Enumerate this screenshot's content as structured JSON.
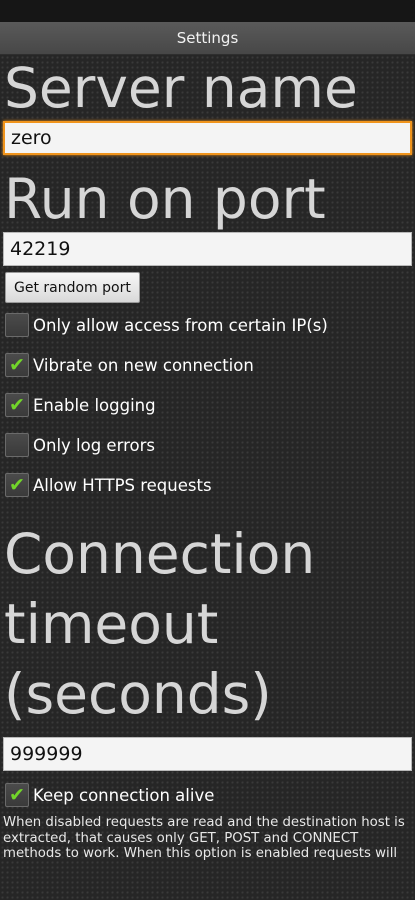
{
  "title_bar": {
    "title": "Settings"
  },
  "server_name": {
    "heading": "Server name",
    "value": "zero"
  },
  "port": {
    "heading": "Run on port",
    "value": "42219",
    "random_button": "Get random port"
  },
  "options": [
    {
      "label": "Only allow access from certain IP(s)",
      "checked": false
    },
    {
      "label": "Vibrate on new connection",
      "checked": true
    },
    {
      "label": "Enable logging",
      "checked": true
    },
    {
      "label": "Only log errors",
      "checked": false
    },
    {
      "label": "Allow HTTPS requests",
      "checked": true
    }
  ],
  "timeout": {
    "heading_line1": "Connection",
    "heading_line2": "timeout",
    "heading_line3": "(seconds)",
    "value": "999999"
  },
  "keep_alive": {
    "label": "Keep connection alive",
    "checked": true
  },
  "description": "When disabled requests are read and the destination host is extracted, that causes only GET, POST and CONNECT methods to work. When this option is enabled requests will",
  "colors": {
    "accent_focus": "#f0941c",
    "check_mark": "#72d52a",
    "title_bar": "#505050"
  }
}
